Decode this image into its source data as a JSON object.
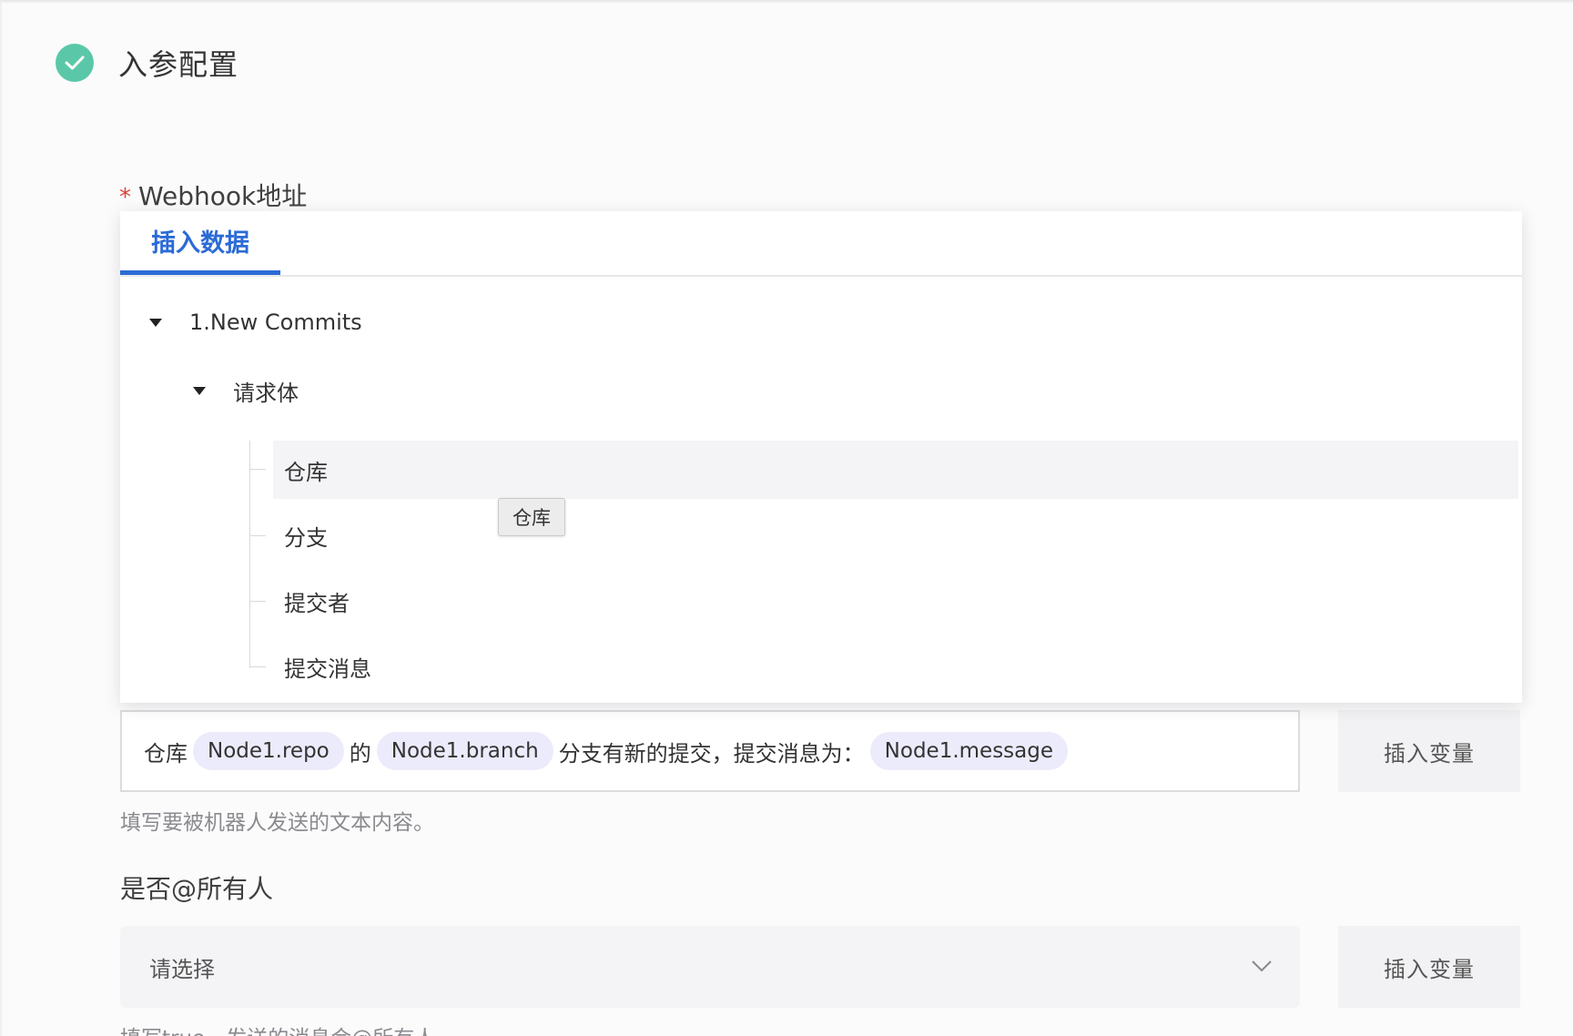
{
  "step": {
    "title": "入参配置",
    "status_color": "#5ac8a8"
  },
  "webhook": {
    "required_mark": "*",
    "label": "Webhook地址"
  },
  "insert_panel": {
    "tab_label": "插入数据",
    "tree": {
      "node_label": "1.New Commits",
      "group_label": "请求体",
      "leaves": [
        "仓库",
        "分支",
        "提交者",
        "提交消息"
      ]
    },
    "tooltip": "仓库"
  },
  "message_field": {
    "segments": {
      "t1": "仓库",
      "chip1": "Node1.repo",
      "t2": "的",
      "chip2": "Node1.branch",
      "t3": "分支有新的提交，提交消息为：",
      "chip3": "Node1.message"
    },
    "insert_var_label": "插入变量",
    "hint": "填写要被机器人发送的文本内容。"
  },
  "at_all_field": {
    "label": "是否@所有人",
    "placeholder": "请选择",
    "insert_var_label": "插入变量",
    "hint": "填写true，发送的消息会@所有人"
  },
  "colors": {
    "accent": "#2b6bd6",
    "chip_bg": "#ecebfb",
    "required": "#e0413b"
  }
}
